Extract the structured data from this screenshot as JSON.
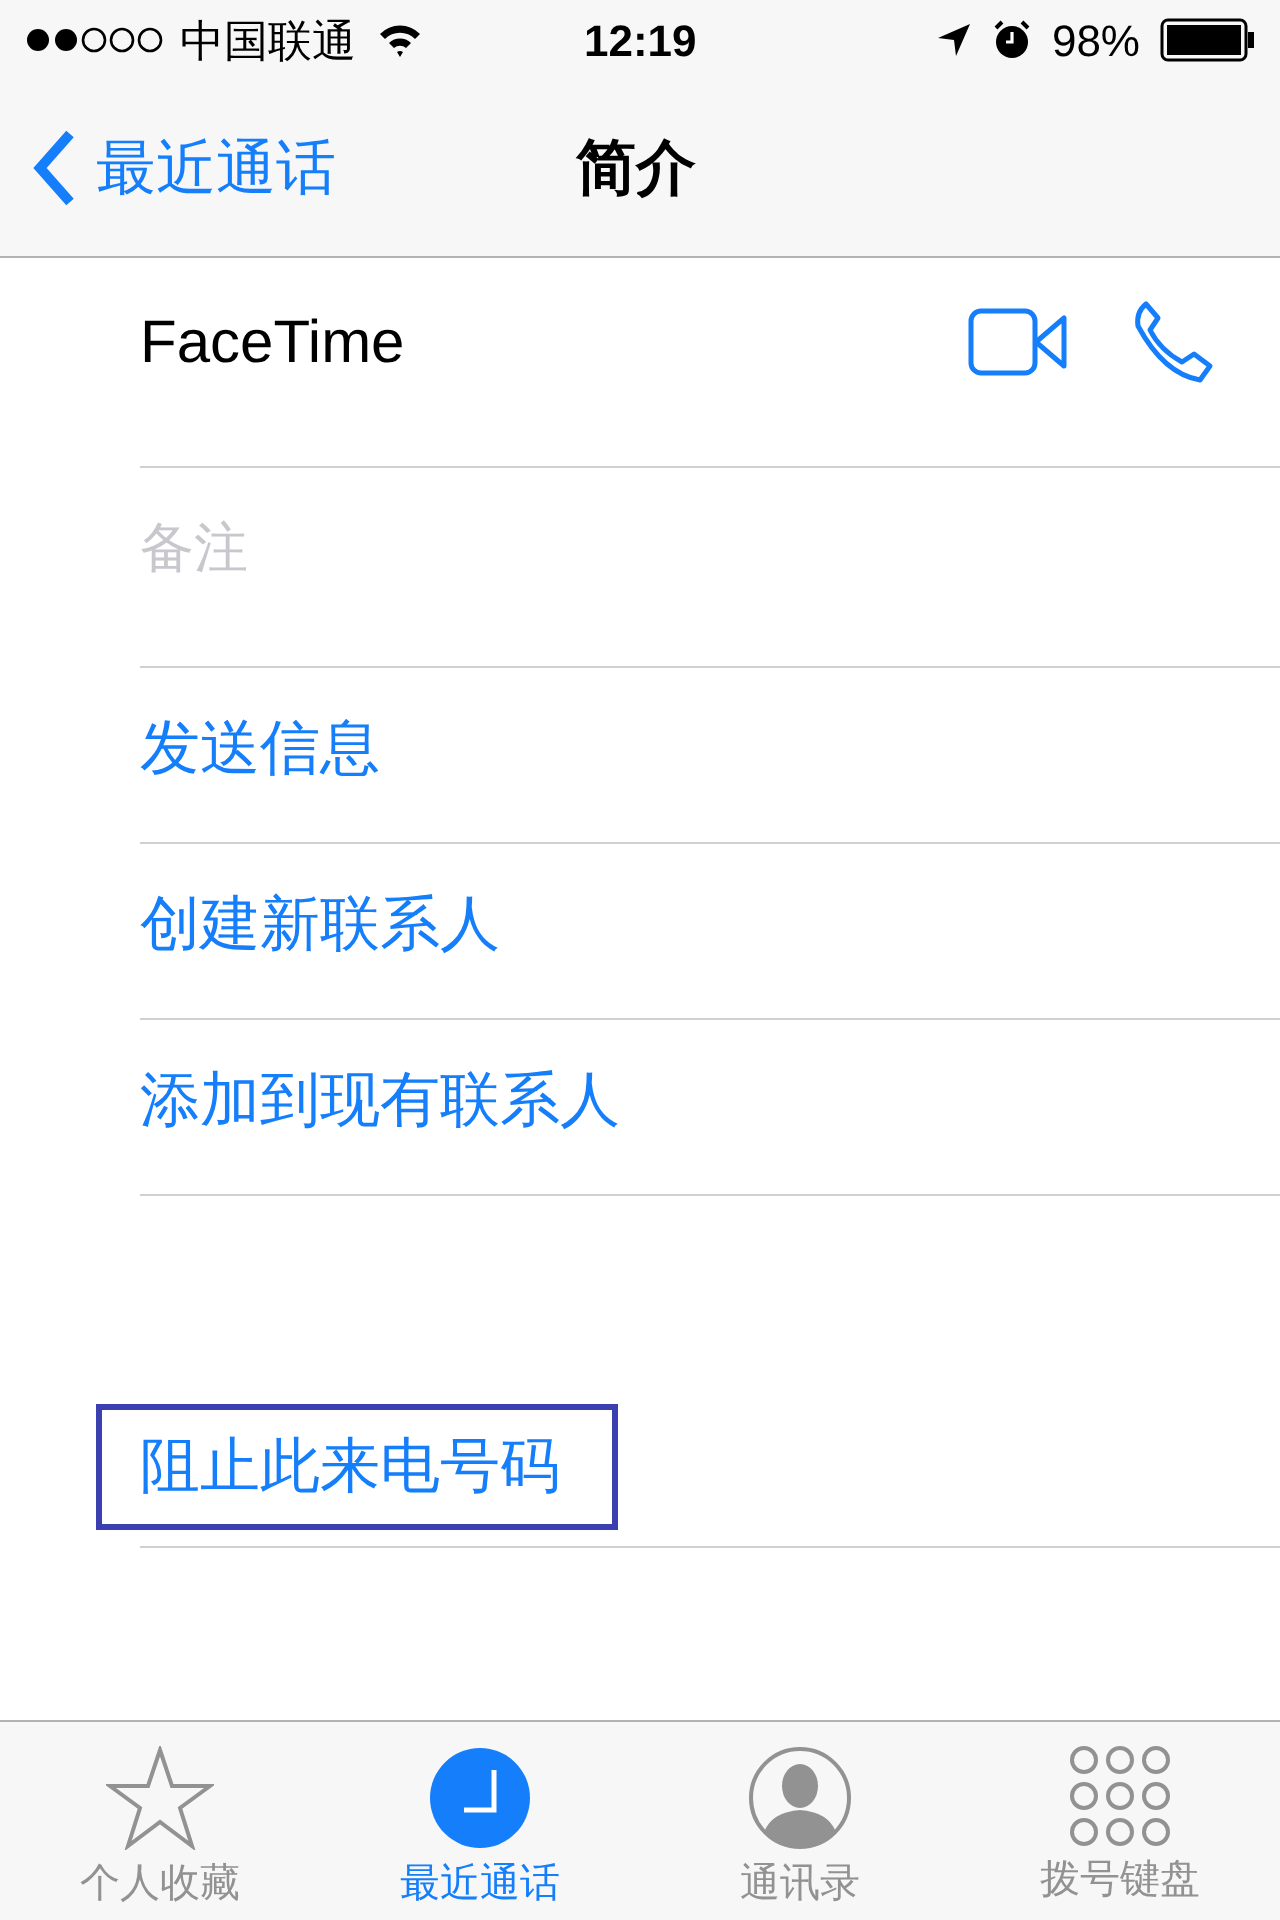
{
  "status_bar": {
    "carrier": "中国联通",
    "time": "12:19",
    "battery": "98%"
  },
  "nav_bar": {
    "back": "最近通话",
    "title": "简介"
  },
  "facetime": {
    "label": "FaceTime"
  },
  "note": {
    "placeholder": "备注"
  },
  "actions": [
    {
      "label": "发送信息"
    },
    {
      "label": "创建新联系人"
    },
    {
      "label": "添加到现有联系人"
    }
  ],
  "block": {
    "label": "阻止此来电号码",
    "highlighted": true
  },
  "tab_bar": [
    {
      "label": "个人收藏",
      "selected": false
    },
    {
      "label": "最近通话",
      "selected": true
    },
    {
      "label": "通讯录",
      "selected": false
    },
    {
      "label": "拨号键盘",
      "selected": false
    }
  ]
}
